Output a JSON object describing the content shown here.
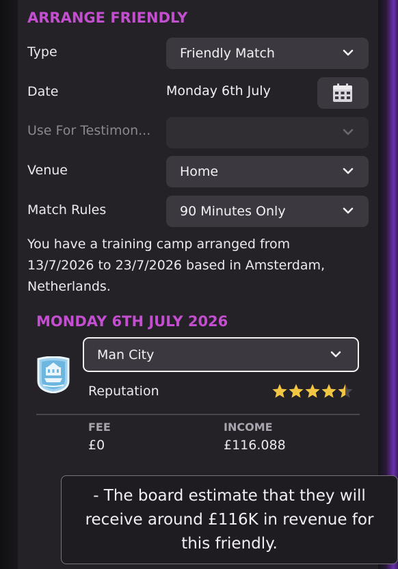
{
  "panel": {
    "title": "ARRANGE FRIENDLY"
  },
  "form": {
    "type": {
      "label": "Type",
      "value": "Friendly Match"
    },
    "date": {
      "label": "Date",
      "value": "Monday 6th July"
    },
    "testimonial": {
      "label": "Use For Testimon...",
      "value": ""
    },
    "venue": {
      "label": "Venue",
      "value": "Home"
    },
    "match_rules": {
      "label": "Match Rules",
      "value": "90 Minutes Only"
    }
  },
  "info": {
    "text": "You have a training camp arranged from 13/7/2026 to 23/7/2026 based in Amsterdam, Netherlands."
  },
  "fixture": {
    "date_title": "MONDAY 6TH JULY 2026",
    "opponent": "Man City",
    "reputation_label": "Reputation",
    "reputation_stars": 4.5,
    "reputation_max": 5,
    "fee_label": "FEE",
    "fee_value": "£0",
    "income_label": "INCOME",
    "income_value": "£116.088"
  },
  "tooltip": {
    "text": "- The board estimate that they will receive around £116K in revenue for this friendly."
  },
  "colors": {
    "accent": "#c34fd0",
    "panel": "#242127",
    "field": "#3b383f",
    "star": "#f2c542"
  }
}
